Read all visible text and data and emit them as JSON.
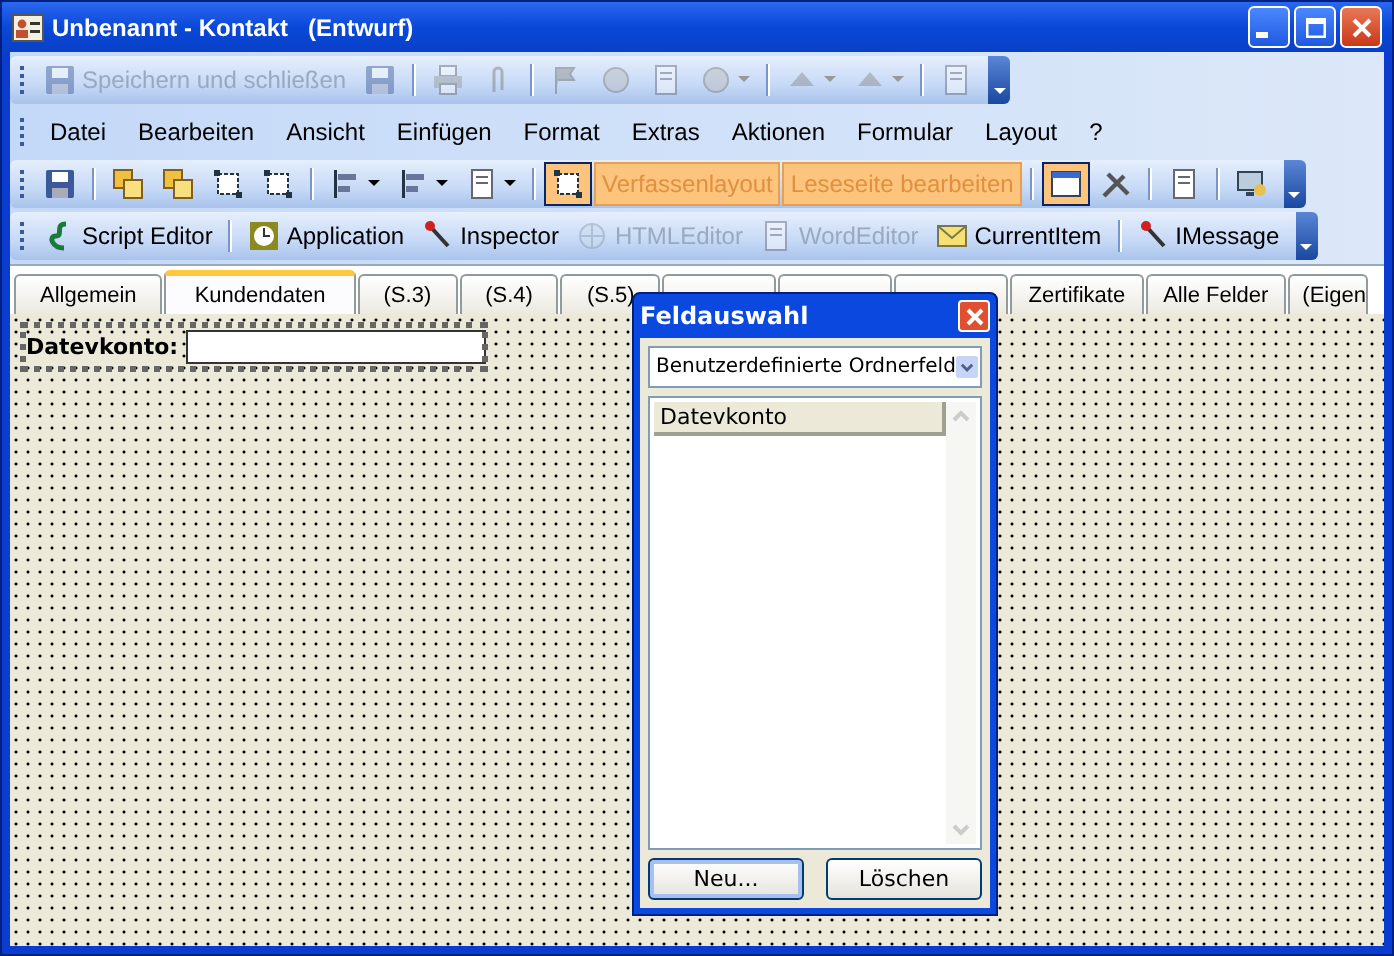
{
  "window": {
    "title": "Unbenannt - Kontakt   (Entwurf)"
  },
  "toolbars": [
    {
      "kind": "toolbar",
      "items": [
        {
          "kind": "icon-button",
          "label": "Speichern und schließen",
          "disabled": true
        },
        {
          "kind": "icon",
          "disabled": true
        },
        {
          "kind": "separator"
        },
        {
          "kind": "icon",
          "disabled": true
        },
        {
          "kind": "icon",
          "disabled": true
        },
        {
          "kind": "separator"
        },
        {
          "kind": "icon",
          "disabled": true
        },
        {
          "kind": "icon",
          "disabled": true
        },
        {
          "kind": "icon",
          "disabled": true
        },
        {
          "kind": "dropdown",
          "disabled": true
        },
        {
          "kind": "separator"
        },
        {
          "kind": "dropdown",
          "disabled": true
        },
        {
          "kind": "dropdown",
          "disabled": true
        },
        {
          "kind": "separator"
        },
        {
          "kind": "icon",
          "disabled": true
        }
      ]
    },
    {
      "kind": "menu",
      "items": [
        {
          "label": "Datei"
        },
        {
          "label": "Bearbeiten"
        },
        {
          "label": "Ansicht"
        },
        {
          "label": "Einfügen"
        },
        {
          "label": "Format"
        },
        {
          "label": "Extras"
        },
        {
          "label": "Aktionen"
        },
        {
          "label": "Formular"
        },
        {
          "label": "Layout"
        },
        {
          "label": "?"
        }
      ]
    },
    {
      "kind": "toolbar",
      "items": [
        {
          "kind": "icon",
          "disabled": false
        },
        {
          "kind": "separator"
        },
        {
          "kind": "icon",
          "disabled": false
        },
        {
          "kind": "icon",
          "disabled": false
        },
        {
          "kind": "icon",
          "disabled": false
        },
        {
          "kind": "icon",
          "disabled": false
        },
        {
          "kind": "separator"
        },
        {
          "kind": "dropdown",
          "disabled": false
        },
        {
          "kind": "dropdown",
          "disabled": false
        },
        {
          "kind": "dropdown",
          "disabled": false
        },
        {
          "kind": "separator"
        },
        {
          "kind": "icon",
          "disabled": false,
          "pressed": true
        },
        {
          "kind": "button",
          "label": "Verfassenlayout",
          "disabled": true,
          "pressed": true
        },
        {
          "kind": "button",
          "label": "Leseseite bearbeiten",
          "disabled": true,
          "pressed": true
        },
        {
          "kind": "separator"
        },
        {
          "kind": "icon",
          "disabled": false,
          "pressed": true
        },
        {
          "kind": "icon",
          "disabled": false
        },
        {
          "kind": "separator"
        },
        {
          "kind": "icon",
          "disabled": false
        },
        {
          "kind": "separator"
        },
        {
          "kind": "icon",
          "disabled": false
        }
      ]
    },
    {
      "kind": "toolbar",
      "items": [
        {
          "kind": "icon-button",
          "label": "Script Editor",
          "disabled": false
        },
        {
          "kind": "separator"
        },
        {
          "kind": "icon-button",
          "label": "Application",
          "disabled": false
        },
        {
          "kind": "icon-button",
          "label": "Inspector",
          "disabled": false
        },
        {
          "kind": "icon-button",
          "label": "HTMLEditor",
          "disabled": true
        },
        {
          "kind": "icon-button",
          "label": "WordEditor",
          "disabled": true
        },
        {
          "kind": "icon-button",
          "label": "CurrentItem",
          "disabled": false
        },
        {
          "kind": "separator"
        },
        {
          "kind": "icon-button",
          "label": "IMessage",
          "disabled": false
        }
      ]
    }
  ],
  "tabs": [
    {
      "label": "Allgemein",
      "selected": false
    },
    {
      "label": "Kundendaten",
      "selected": true
    },
    {
      "label": "(S.3)",
      "selected": false
    },
    {
      "label": "(S.4)",
      "selected": false
    },
    {
      "label": "(S.5)",
      "selected": false
    },
    {
      "selected": false
    },
    {
      "selected": false
    },
    {
      "selected": false
    },
    {
      "label": "Zertifikate",
      "selected": false
    },
    {
      "label": "Alle Felder",
      "selected": false
    },
    {
      "label": "(Eigen",
      "selected": false
    }
  ],
  "form": {
    "fields": [
      {
        "label": "Datevkonto:",
        "selected": true
      }
    ]
  },
  "dialog": {
    "title": "Feldauswahl",
    "dropdown": "Benutzerdefinierte Ordnerfeld",
    "items": [
      {
        "label": "Datevkonto"
      }
    ],
    "buttons": [
      {
        "label": "Neu...",
        "default": true
      },
      {
        "label": "Löschen",
        "default": false
      }
    ]
  }
}
